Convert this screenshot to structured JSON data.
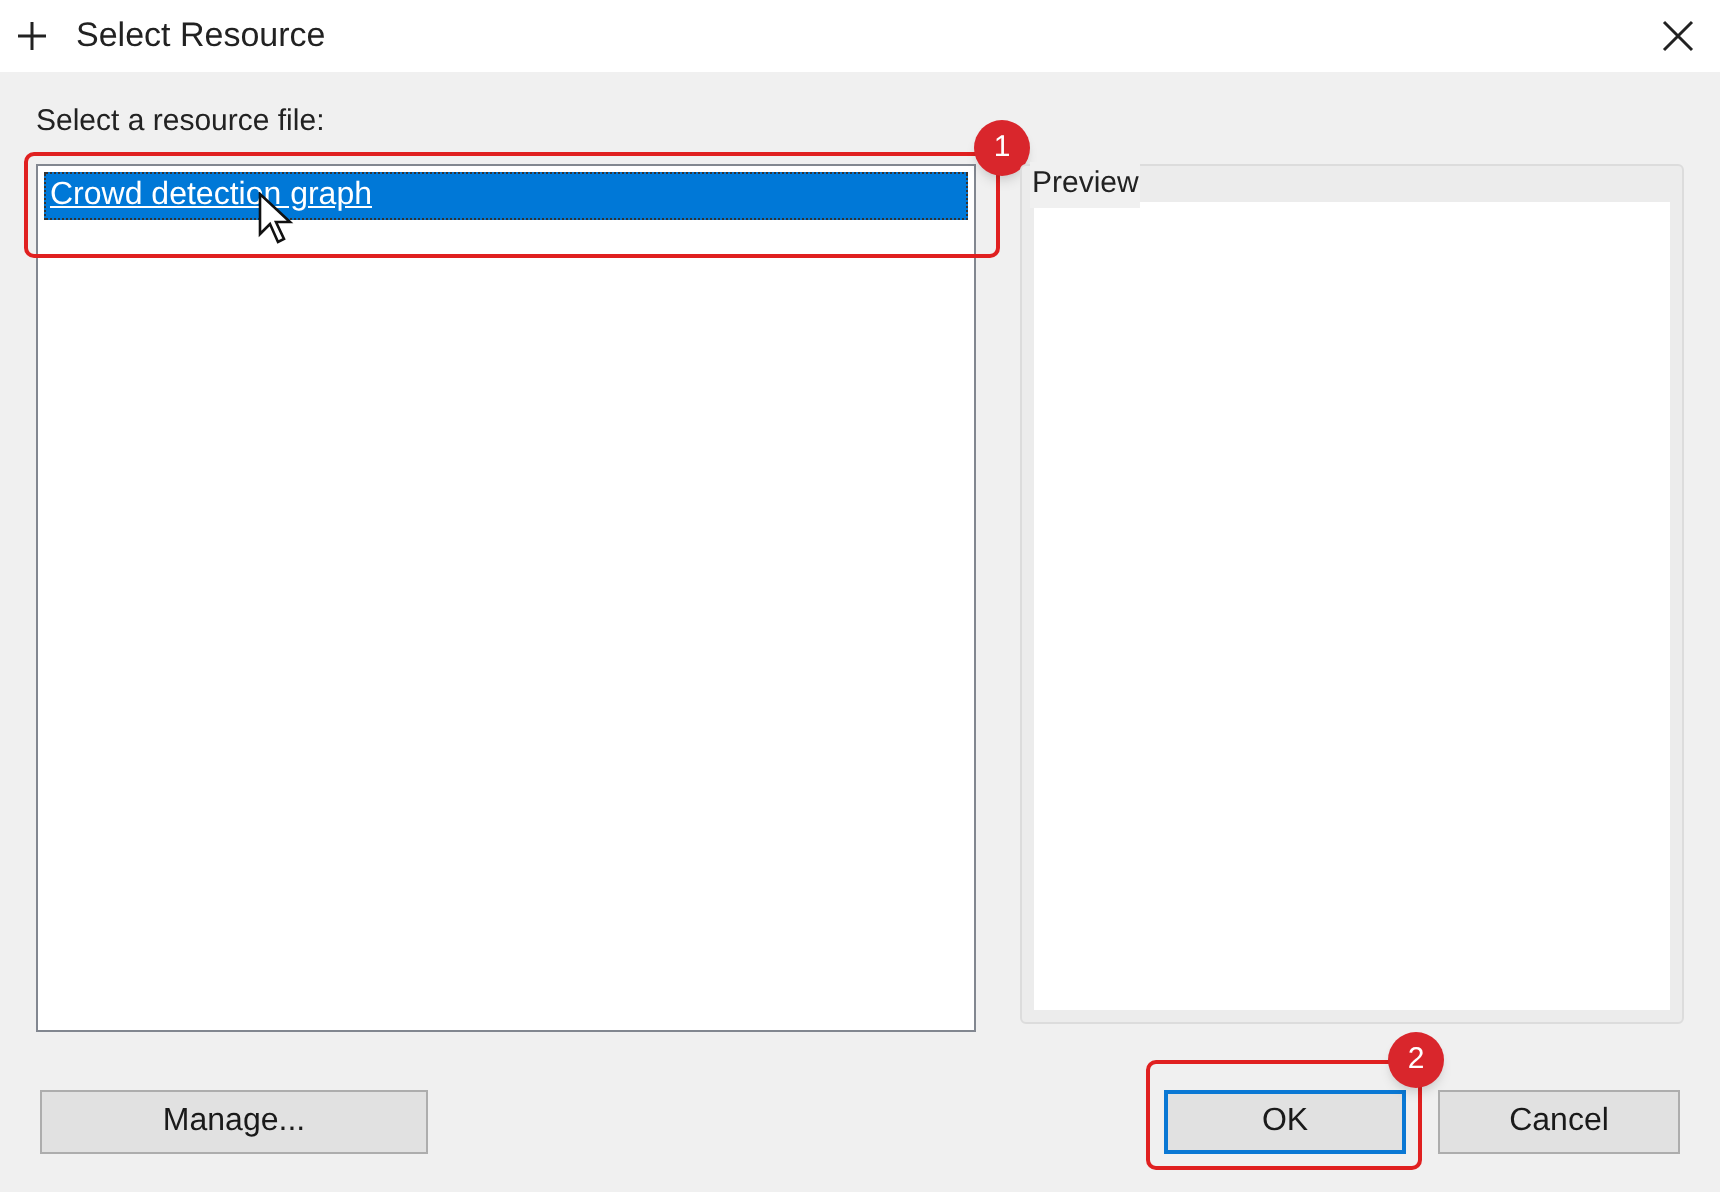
{
  "window": {
    "title": "Select Resource"
  },
  "prompt": "Select a resource file:",
  "resource_list": {
    "callout": "1",
    "items": [
      {
        "label": "Crowd detection graph",
        "selected": true
      }
    ]
  },
  "preview": {
    "title": "Preview"
  },
  "buttons": [
    {
      "label": "Manage...",
      "kind": "normal"
    },
    {
      "label": "OK",
      "kind": "default",
      "callout": "2"
    },
    {
      "label": "Cancel",
      "kind": "normal"
    }
  ]
}
